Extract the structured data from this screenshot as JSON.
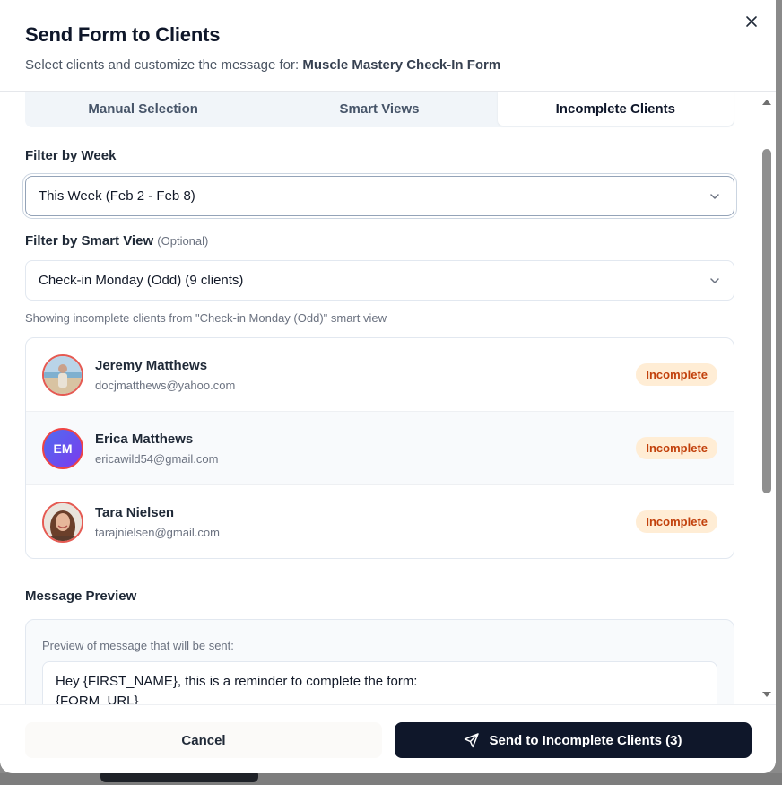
{
  "dialog": {
    "title": "Send Form to Clients",
    "subtitle_prefix": "Select clients and customize the message for: ",
    "form_name": "Muscle Mastery Check-In Form"
  },
  "tabs": [
    {
      "label": "Manual Selection",
      "active": false
    },
    {
      "label": "Smart Views",
      "active": false
    },
    {
      "label": "Incomplete Clients",
      "active": true
    }
  ],
  "week_filter": {
    "label": "Filter by Week",
    "value": "This Week (Feb 2 - Feb 8)"
  },
  "smart_view_filter": {
    "label": "Filter by Smart View",
    "optional": "(Optional)",
    "value": "Check-in Monday (Odd) (9 clients)",
    "helper": "Showing incomplete clients from \"Check-in Monday (Odd)\" smart view"
  },
  "clients": [
    {
      "name": "Jeremy Matthews",
      "email": "docjmatthews@yahoo.com",
      "status": "Incomplete",
      "avatar": "photo-beach"
    },
    {
      "name": "Erica Matthews",
      "email": "ericawild54@gmail.com",
      "status": "Incomplete",
      "initials": "EM"
    },
    {
      "name": "Tara Nielsen",
      "email": "tarajnielsen@gmail.com",
      "status": "Incomplete",
      "avatar": "photo-portrait"
    }
  ],
  "message_preview": {
    "label": "Message Preview",
    "caption": "Preview of message that will be sent:",
    "line1": "Hey {FIRST_NAME}, this is a reminder to complete the form:",
    "line2": "{FORM_URL}"
  },
  "footer": {
    "cancel_label": "Cancel",
    "send_label": "Send to Incomplete Clients (3)"
  },
  "colors": {
    "primary": "#0f172a",
    "badge_bg": "#ffedd5",
    "badge_text": "#c2410c",
    "initials_avatar": "#5b5ff0"
  },
  "icons": {
    "close": "close-icon",
    "chevron": "chevron-down-icon",
    "send": "send-icon"
  }
}
